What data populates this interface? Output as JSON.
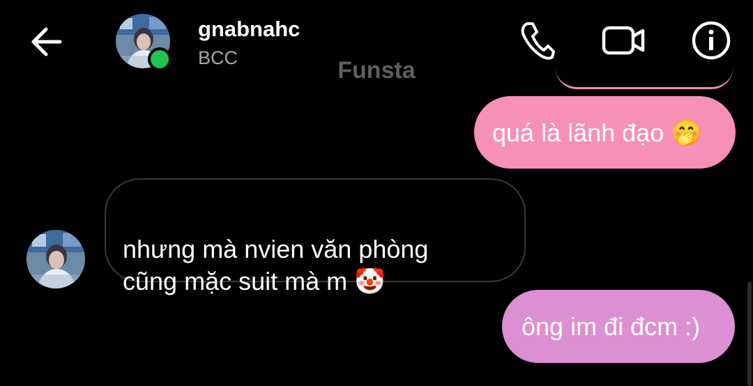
{
  "header": {
    "contact_name": "gnabnahc",
    "contact_subtitle": "BCC",
    "account_label": "Funsta",
    "online_status": "online",
    "icons": {
      "back": "arrow-left-icon",
      "call": "phone-icon",
      "video": "video-camera-icon",
      "info": "info-icon"
    }
  },
  "messages": [
    {
      "direction": "outgoing",
      "text": "quá là lãnh đạo 🤭"
    },
    {
      "direction": "incoming",
      "text": "nhưng mà nvien văn phòng\ncũng mặc suit mà m 🤡"
    },
    {
      "direction": "outgoing",
      "text": "ông im đi đcm :)"
    }
  ],
  "colors": {
    "background": "#000000",
    "outgoing_bubble_pink": "#f690b6",
    "outgoing_bubble_violet": "#dc8fd2",
    "incoming_bubble_border": "#3a3a3a",
    "online_dot": "#1fc34f",
    "subtitle_gray": "#a8a8a8",
    "account_label_gray": "#5e5e5e"
  }
}
